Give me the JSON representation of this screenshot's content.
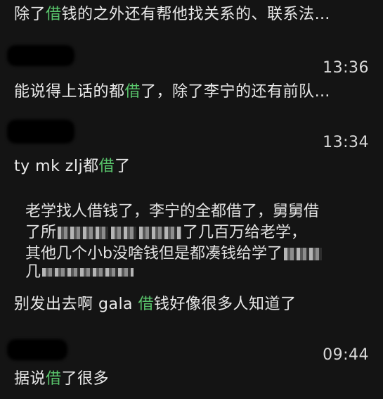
{
  "messages": [
    {
      "parts": [
        "除了",
        "借",
        "钱的之外还有帮他找关系的、联系法…"
      ]
    },
    {
      "time": "13:36",
      "parts": [
        "能说得上话的都",
        "借",
        "了，除了李宁的还有前队…"
      ]
    },
    {
      "time": "13:34",
      "parts": [
        "ty mk zlj都",
        "借",
        "了"
      ]
    },
    {
      "forward_lines": [
        "老学找人借钱了，李宁的全都借了，舅舅借",
        "了所",
        "了几百万给老学，",
        "其他几个小b没啥钱但是都凑钱给学了",
        "几"
      ]
    },
    {
      "parts": [
        "别发出去啊 gala ",
        "借",
        "钱好像很多人知道了"
      ]
    },
    {
      "time": "09:44",
      "parts": [
        "据说",
        "借",
        "了很多"
      ]
    }
  ],
  "colors": {
    "background": "#141414",
    "text": "#e9e9e9",
    "highlight": "#59c46b"
  }
}
